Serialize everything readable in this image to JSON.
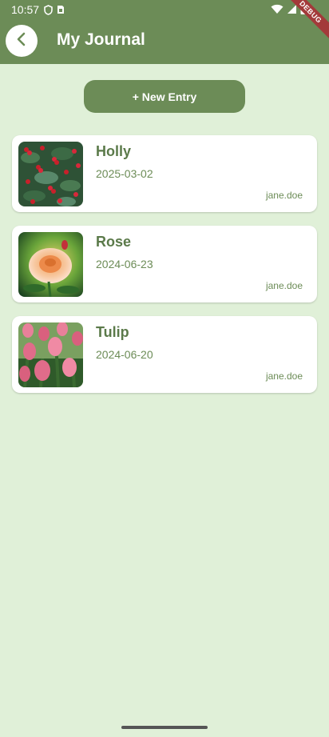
{
  "status_bar": {
    "time": "10:57",
    "icons": [
      "shield-icon",
      "sim-card-icon",
      "wifi-icon",
      "signal-icon",
      "battery-icon"
    ]
  },
  "app_bar": {
    "title": "My Journal",
    "back_icon": "arrow-back-icon",
    "debug_label": "DEBUG"
  },
  "actions": {
    "new_entry_label": "+ New Entry"
  },
  "entries": [
    {
      "title": "Holly",
      "date": "2025-03-02",
      "author": "jane.doe",
      "image": "holly-photo"
    },
    {
      "title": "Rose",
      "date": "2024-06-23",
      "author": "jane.doe",
      "image": "rose-photo"
    },
    {
      "title": "Tulip",
      "date": "2024-06-20",
      "author": "jane.doe",
      "image": "tulip-photo"
    }
  ],
  "colors": {
    "primary": "#6c8c57",
    "background": "#e0f0d8",
    "card": "#ffffff",
    "debug": "#a33a3a"
  }
}
